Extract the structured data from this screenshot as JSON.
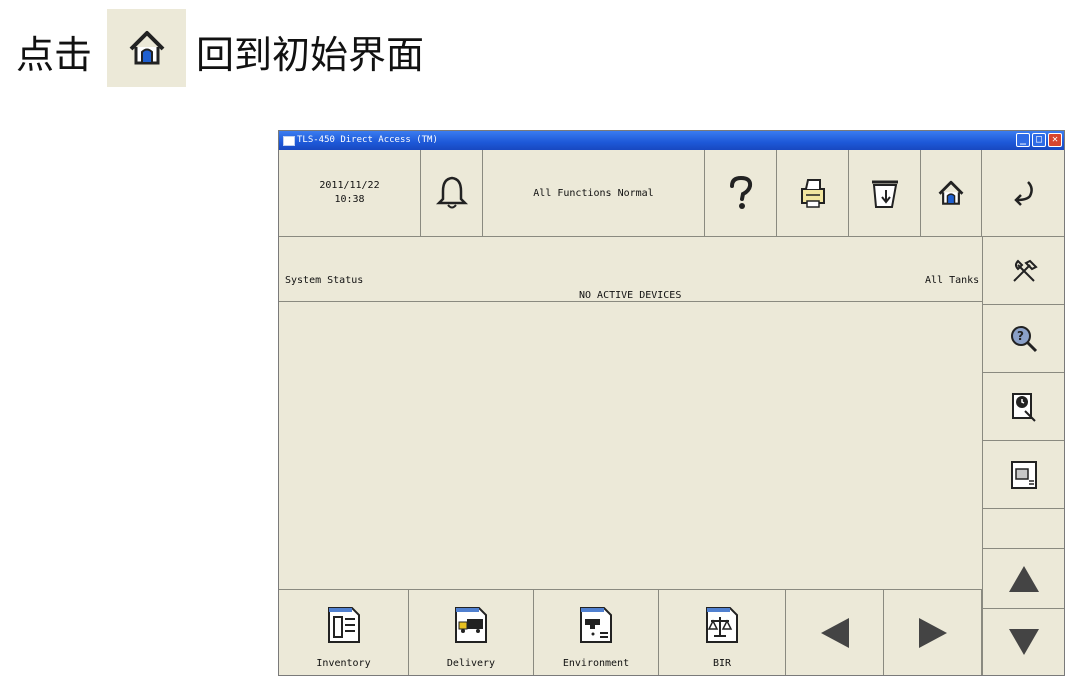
{
  "instruction": {
    "prefix": "点击",
    "suffix": "回到初始界面",
    "icon": "home-icon"
  },
  "window": {
    "title": "TLS-450 Direct Access (TM)",
    "controls": {
      "minimize": "_",
      "maximize": "□",
      "close": "✕"
    }
  },
  "header": {
    "date": "2011/11/22",
    "time": "10:38",
    "status_message": "All Functions Normal",
    "buttons": [
      "bell-icon",
      "help-icon",
      "printer-icon",
      "receipt-icon",
      "home-icon",
      "back-icon"
    ]
  },
  "main": {
    "title": "System Status",
    "scope": "All Tanks",
    "message": "NO ACTIVE DEVICES"
  },
  "sidebar": {
    "buttons": [
      "tools-icon",
      "diagnostics-icon",
      "timer-icon",
      "reports-icon",
      "up-arrow-icon",
      "down-arrow-icon"
    ]
  },
  "bottom_nav": {
    "items": [
      {
        "label": "Inventory",
        "icon": "inventory-icon"
      },
      {
        "label": "Delivery",
        "icon": "delivery-icon"
      },
      {
        "label": "Environment",
        "icon": "environment-icon"
      },
      {
        "label": "BIR",
        "icon": "bir-icon"
      }
    ],
    "prev": "left-arrow-icon",
    "next": "right-arrow-icon"
  }
}
